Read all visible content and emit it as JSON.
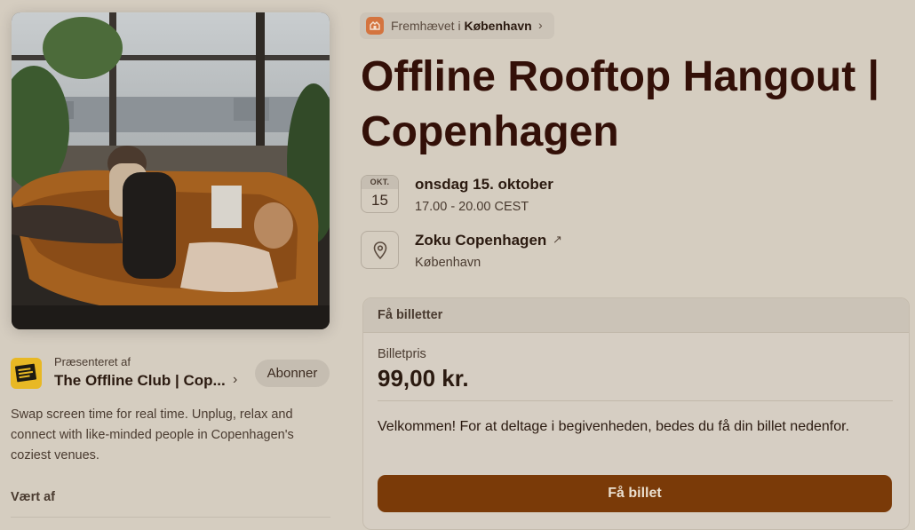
{
  "event": {
    "featured_prefix": "Fremhævet i",
    "featured_city": "København",
    "title": "Offline Rooftop Hangout | Copenhagen",
    "date": {
      "month": "OKT.",
      "day": "15",
      "full": "onsdag 15. oktober",
      "time": "17.00 - 20.00 CEST"
    },
    "location": {
      "name": "Zoku Copenhagen",
      "city": "København"
    }
  },
  "host": {
    "presented_by": "Præsenteret af",
    "name": "The Offline Club | Cop...",
    "subscribe_label": "Abonner",
    "description": "Swap screen time for real time. Unplug, relax and connect with like-minded people in Copenhagen's coziest venues.",
    "hosted_by_label": "Vært af"
  },
  "tickets": {
    "header": "Få billetter",
    "price_label": "Billetpris",
    "price": "99,00 kr.",
    "welcome_text": "Velkommen! For at deltage i begivenheden, bedes du få din billet nedenfor.",
    "button_label": "Få billet"
  },
  "colors": {
    "title": "#331008",
    "button_bg": "#7a3a08",
    "page_bg": "#d5cdc0",
    "featured_icon": "#d4743f",
    "host_logo": "#e8b824"
  },
  "icons": {
    "featured": "ticket-icon",
    "location": "map-pin-icon",
    "external": "arrow-up-right-icon",
    "chevron": "chevron-right-icon"
  }
}
